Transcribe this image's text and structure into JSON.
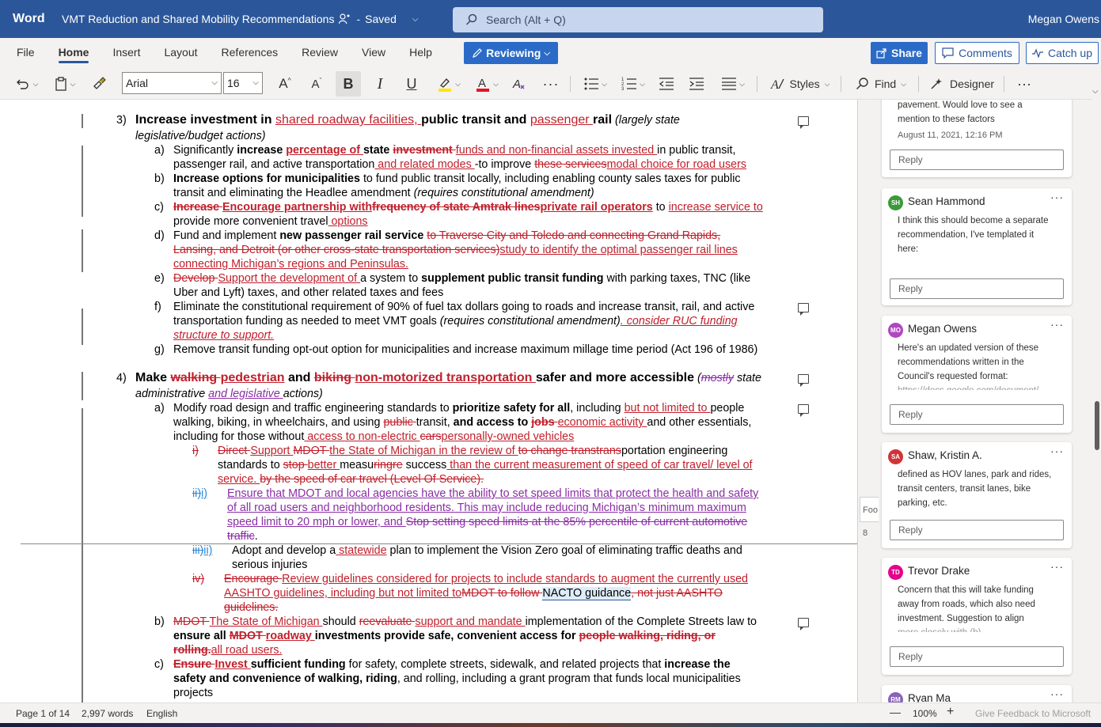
{
  "titlebar": {
    "app": "Word",
    "doc_title": "VMT Reduction and Shared Mobility Recommendations",
    "status": "Saved",
    "search_placeholder": "Search (Alt + Q)",
    "user": "Megan Owens"
  },
  "menu": {
    "items": [
      "File",
      "Home",
      "Insert",
      "Layout",
      "References",
      "Review",
      "View",
      "Help"
    ],
    "active": "Home",
    "reviewing": "Reviewing",
    "share": "Share",
    "comments": "Comments",
    "catch_up": "Catch up"
  },
  "toolbar": {
    "font": "Arial",
    "size": "16",
    "styles": "Styles",
    "find": "Find",
    "designer": "Designer"
  },
  "document": {
    "item3": {
      "num": "3)",
      "p1": "Increase investment in ",
      "p2": "shared roadway facilities, ",
      "p3": "public transit and ",
      "p4": "passenger ",
      "p5": "rail",
      "p6": " (largely state",
      "l2": "legislative/budget actions)"
    },
    "a3": {
      "num": "a)",
      "t1": "Significantly ",
      "t2": "increase ",
      "t3": "percentage of ",
      "t4": "state ",
      "t5": "investment ",
      "t6": "funds and non-financial assets invested ",
      "t7": "in public transit,",
      "l2a": "passenger rail, and active transportation",
      "l2b": " and related modes ",
      "l2c": "-to improve ",
      "l2d": "these services",
      "l2e": "modal choice for road users"
    },
    "b3": {
      "num": "b)",
      "t1": "Increase options for municipalities",
      "t2": " to fund public transit locally, including enabling county sales taxes for public",
      "l2a": "transit and eliminating the Headlee amendment ",
      "l2b": "(requires constitutional amendment)"
    },
    "c3": {
      "num": "c)",
      "t1": "Increase ",
      "t2": "Encourage partnership with",
      "t3": "frequency of state Amtrak lines",
      "t4": "private rail operators",
      "t5": " to ",
      "t6": "increase service to",
      "l2a": "provide more convenient travel",
      "l2b": " options"
    },
    "d3": {
      "num": "d)",
      "t1": "Fund and implement ",
      "t2": "new passenger rail service",
      "t3": " ",
      "t4": "to Traverse City and Toledo and connecting Grand Rapids,",
      "l2a": "Lansing, and Detroit (or other cross-state transportation services)",
      "l2b": "study to identify the optimal passenger rail lines",
      "l3": "connecting Michigan’s regions and Peninsulas. "
    },
    "e3": {
      "num": "e)",
      "t1": "Develop ",
      "t2": "Support the development of ",
      "t3": "a system to ",
      "t4": "supplement public transit funding",
      "t5": " with parking taxes, TNC (like",
      "l2": "Uber and Lyft) taxes, and other related taxes and fees"
    },
    "f3": {
      "num": "f)",
      "t1": "Eliminate the constitutional requirement of 90% of fuel tax dollars going to roads and increase transit, rail, and active",
      "l2a": "transportation funding as needed to meet VMT goals ",
      "l2b": "(requires constitutional amendment)",
      "l2c": ". consider RUC funding",
      "l3": "structure to support. "
    },
    "g3": {
      "num": "g)",
      "t1": "Remove transit funding opt-out option for municipalities and increase maximum millage time period (Act 196 of 1986)"
    },
    "item4": {
      "num": "4)",
      "p1": "Make ",
      "p2": "walking ",
      "p3": "pedestrian",
      "p4": " and ",
      "p5": "biking ",
      "p6": "non-motorized transportation ",
      "p7": "safer and more accessible",
      "p8": " (",
      "p9": "mostly",
      "p10": " state",
      "l2a": "administrative ",
      "l2b": "and legislative ",
      "l2c": "actions)"
    },
    "a4": {
      "num": "a)",
      "t1": "Modify road design and traffic engineering standards to ",
      "t2": "prioritize safety for all",
      "t3": ", including ",
      "t4": "but not limited to ",
      "t5": "people",
      "l2a": "walking, biking, in wheelchairs, and using ",
      "l2b": "public ",
      "l2c": "transit, ",
      "l2d": "and access to ",
      "l2e": "jobs ",
      "l2f": "economic activity ",
      "l2g": "and other essentials,",
      "l3a": "including for those without",
      "l3b": " access to non-electric ",
      "l3c": "cars",
      "l3d": "personally-owned vehicles "
    },
    "a4i": {
      "num": "i)",
      "t1": "Direct ",
      "t2": "Support ",
      "t3": "MDOT ",
      "t4": "the State of Michigan ",
      "t5": " in the review of ",
      "t6": "to change transtrans",
      "t7": "portation engineering",
      "l2a": "standards to ",
      "l2b": "stop ",
      "l2c": "better ",
      "l2d": "measu",
      "l2e": "ringre",
      "l2f": " success",
      "l2g": " than the current measurement of speed of car travel/ level of",
      "l3a": "service. ",
      "l3b": " by the speed of car travel (Level Of Service). "
    },
    "a4ii": {
      "num_del": "ii)",
      "num_ins": "i)",
      "l1": "Ensure that MDOT and local agencies have the ability to set speed limits that protect the health and safety",
      "l2": "of all road users and neighborhood residents. This may include reducing Michigan’s minimum maximum",
      "l3a": "speed limit to 20 mph or lower, and ",
      "l3b": "Stop setting speed limits at the 85% percentile of current automotive",
      "l4": "traffic",
      "l4b": "."
    },
    "a4iii": {
      "num_del": "iii)",
      "num_ins": "ii)",
      "t1": "Adopt and develop a",
      "t2": " statewide",
      "t3": " plan to implement the Vision Zero goal of eliminating traffic deaths and",
      "l2": "serious injuries"
    },
    "a4iv": {
      "num": "iv)",
      "t1": "Encourage ",
      "t2": "Review guidelines considered for projects to include standards to augment the currently used",
      "l2a": "AASHTO guidelines, including but not limited to",
      "l2b": "MDOT to follow ",
      "l2c": "NACTO guidance",
      "l2d": ", not just AASHTO",
      "l3": "guidelines. "
    },
    "b4": {
      "num": "b)",
      "t1": "MDOT ",
      "t2": "The State of Michigan ",
      "t3": "should ",
      "t4": "reevaluate ",
      "t5": "support and mandate ",
      "t6": "implementation of the Complete Streets law to",
      "l2a": "ensure all ",
      "l2b": "MDOT ",
      "l2c": "roadway ",
      "l2d": "investments provide safe, convenient access for ",
      "l2e": "people walking, riding, or",
      "l3a": "rolling.",
      "l3b": "all road users."
    },
    "c4": {
      "num": "c)",
      "t1": "Ensure ",
      "t2": "Invest ",
      "t3": "sufficient funding",
      "t4": " for safety, complete streets, sidewalk, and related projects that ",
      "t5": "increase the",
      "l2a": "safety and convenience of walking, riding",
      "l2b": ", and rolling, including a grant program that funds local municipalities",
      "l3": "projects"
    }
  },
  "comments": [
    {
      "text1": "pavement. Would love to see a",
      "text2": "mention to these factors",
      "date": "August 11, 2021, 12:16 PM",
      "reply": "Reply"
    },
    {
      "initials": "SH",
      "author": "Sean Hammond",
      "color": "#3a9a3a",
      "text1": "I think this should become a separate",
      "text2": "recommendation, I've templated it",
      "text3": "here:",
      "reply": "Reply"
    },
    {
      "initials": "MO",
      "author": "Megan Owens",
      "color": "#b146c2",
      "text1": "Here's an updated version of these",
      "text2": "recommendations written in the",
      "text3": "Council's requested format:",
      "text4": "https://docs.google.com/document/",
      "reply": "Reply"
    },
    {
      "initials": "SA",
      "author": "Shaw, Kristin A.",
      "color": "#d13438",
      "text1": "defined as HOV lanes, park and rides,",
      "text2": "transit centers, transit lanes, bike",
      "text3": "parking, etc.",
      "reply": "Reply"
    },
    {
      "initials": "TD",
      "author": "Trevor Drake",
      "color": "#e3008c",
      "text1": "Concern that this will take funding",
      "text2": "away from roads, which also need",
      "text3": "investment. Suggestion to align",
      "text4": "more closely with (b)",
      "reply": "Reply"
    },
    {
      "initials": "RM",
      "author": "Ryan Ma",
      "color": "#8764b8"
    }
  ],
  "side": {
    "tab": "Foo",
    "num": "8"
  },
  "statusbar": {
    "page": "Page 1 of 14",
    "words": "2,997 words",
    "language": "English",
    "zoom_minus": "—",
    "zoom": "100%",
    "zoom_plus": "+",
    "feedback": "Give Feedback to Microsoft"
  }
}
